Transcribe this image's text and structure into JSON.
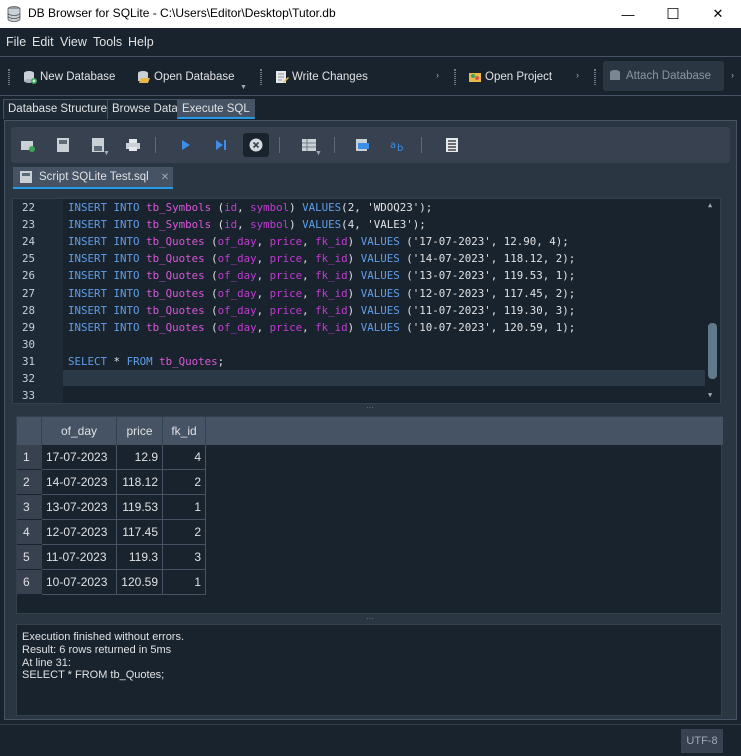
{
  "window": {
    "title": "DB Browser for SQLite - C:\\Users\\Editor\\Desktop\\Tutor.db",
    "minimize": "—",
    "maximize": "☐",
    "close": "✕"
  },
  "menu": [
    "File",
    "Edit",
    "View",
    "Tools",
    "Help"
  ],
  "toolbar": {
    "new_database": "New Database",
    "open_database": "Open Database",
    "write_changes": "Write Changes",
    "open_project": "Open Project",
    "attach_database": "Attach Database"
  },
  "main_tabs": [
    "Database Structure",
    "Browse Data",
    "Execute SQL"
  ],
  "active_main_tab": "Execute SQL",
  "script_tab": {
    "label": "Script SQLite Test.sql",
    "close": "✕"
  },
  "editor": {
    "lines": [
      {
        "n": "22",
        "kind": "symbols",
        "id": "2",
        "val": "'WDOQ23'"
      },
      {
        "n": "23",
        "kind": "symbols",
        "id": "4",
        "val": "'VALE3'"
      },
      {
        "n": "24",
        "kind": "quotes",
        "day": "'17-07-2023'",
        "price": "12.90",
        "fk": "4"
      },
      {
        "n": "25",
        "kind": "quotes",
        "day": "'14-07-2023'",
        "price": "118.12",
        "fk": "2"
      },
      {
        "n": "26",
        "kind": "quotes",
        "day": "'13-07-2023'",
        "price": "119.53",
        "fk": "1"
      },
      {
        "n": "27",
        "kind": "quotes",
        "day": "'12-07-2023'",
        "price": "117.45",
        "fk": "2"
      },
      {
        "n": "28",
        "kind": "quotes",
        "day": "'11-07-2023'",
        "price": "119.30",
        "fk": "3"
      },
      {
        "n": "29",
        "kind": "quotes",
        "day": "'10-07-2023'",
        "price": "120.59",
        "fk": "1"
      },
      {
        "n": "30",
        "kind": "blank"
      },
      {
        "n": "31",
        "kind": "select"
      },
      {
        "n": "32",
        "kind": "blank"
      },
      {
        "n": "33",
        "kind": "blank"
      }
    ],
    "tokens": {
      "insert": "INSERT",
      "into": "INTO",
      "values": "VALUES",
      "select": "SELECT",
      "from": "FROM",
      "star": "*",
      "tb_symbols": "tb_Symbols",
      "tb_quotes": "tb_Quotes",
      "id": "id",
      "symbol": "symbol",
      "of_day": "of_day",
      "price": "price",
      "fk_id": "fk_id"
    }
  },
  "results": {
    "columns": [
      "of_day",
      "price",
      "fk_id"
    ],
    "rows": [
      {
        "n": "1",
        "of_day": "17-07-2023",
        "price": "12.9",
        "fk_id": "4"
      },
      {
        "n": "2",
        "of_day": "14-07-2023",
        "price": "118.12",
        "fk_id": "2"
      },
      {
        "n": "3",
        "of_day": "13-07-2023",
        "price": "119.53",
        "fk_id": "1"
      },
      {
        "n": "4",
        "of_day": "12-07-2023",
        "price": "117.45",
        "fk_id": "2"
      },
      {
        "n": "5",
        "of_day": "11-07-2023",
        "price": "119.3",
        "fk_id": "3"
      },
      {
        "n": "6",
        "of_day": "10-07-2023",
        "price": "120.59",
        "fk_id": "1"
      }
    ]
  },
  "messages": [
    "Execution finished without errors.",
    "Result: 6 rows returned in 5ms",
    "At line 31:",
    "SELECT * FROM tb_Quotes;"
  ],
  "status": {
    "encoding": "UTF-8"
  },
  "colors": {
    "accent": "#259ae9",
    "background": "#19232d",
    "keyword": "#5f9ee8",
    "identifier": "#d957d9"
  }
}
